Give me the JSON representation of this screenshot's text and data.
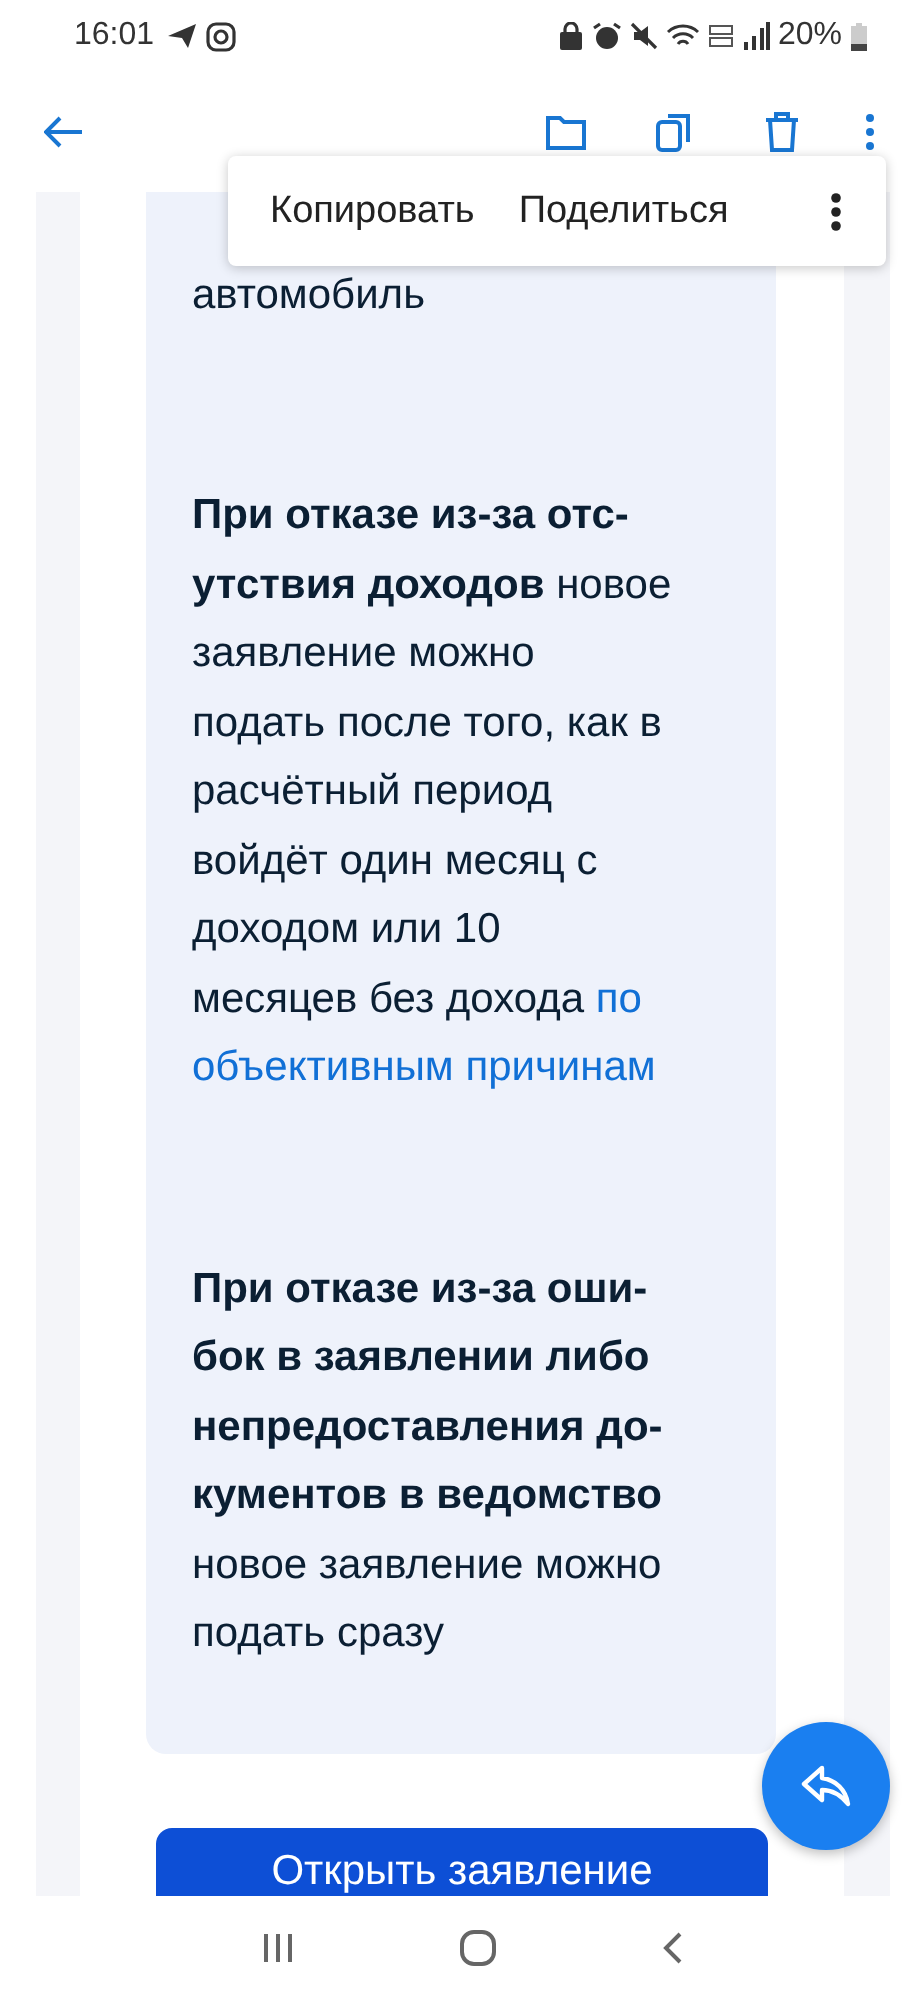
{
  "status_bar": {
    "time": "16:01",
    "battery": "20%"
  },
  "popup_menu": {
    "items": [
      "Копировать",
      "Поделиться"
    ]
  },
  "card": {
    "paragraphs": [
      [
        {
          "kind": "text",
          "text": "автомобиль"
        }
      ],
      [
        {
          "kind": "bold",
          "text": "При отказе из-за отс-\nутствия доходов"
        },
        {
          "kind": "text",
          "text": " новое\nзаявление можно\nподать после того, как в\nрасчётный период\nвойдёт один месяц с\nдоходом или 10\nмесяцев без дохода "
        },
        {
          "kind": "link",
          "text": "по"
        },
        {
          "kind": "break"
        },
        {
          "kind": "link",
          "text": "объективным причинам"
        }
      ],
      [
        {
          "kind": "bold",
          "text": "При отказе из-за оши-\nбок в заявлении либо\nнепредоставления до-\nкументов в ведомство"
        },
        {
          "kind": "text",
          "text": "\nновое заявление можно\nподать сразу"
        }
      ]
    ]
  },
  "button": {
    "label": "Открыть заявление"
  }
}
